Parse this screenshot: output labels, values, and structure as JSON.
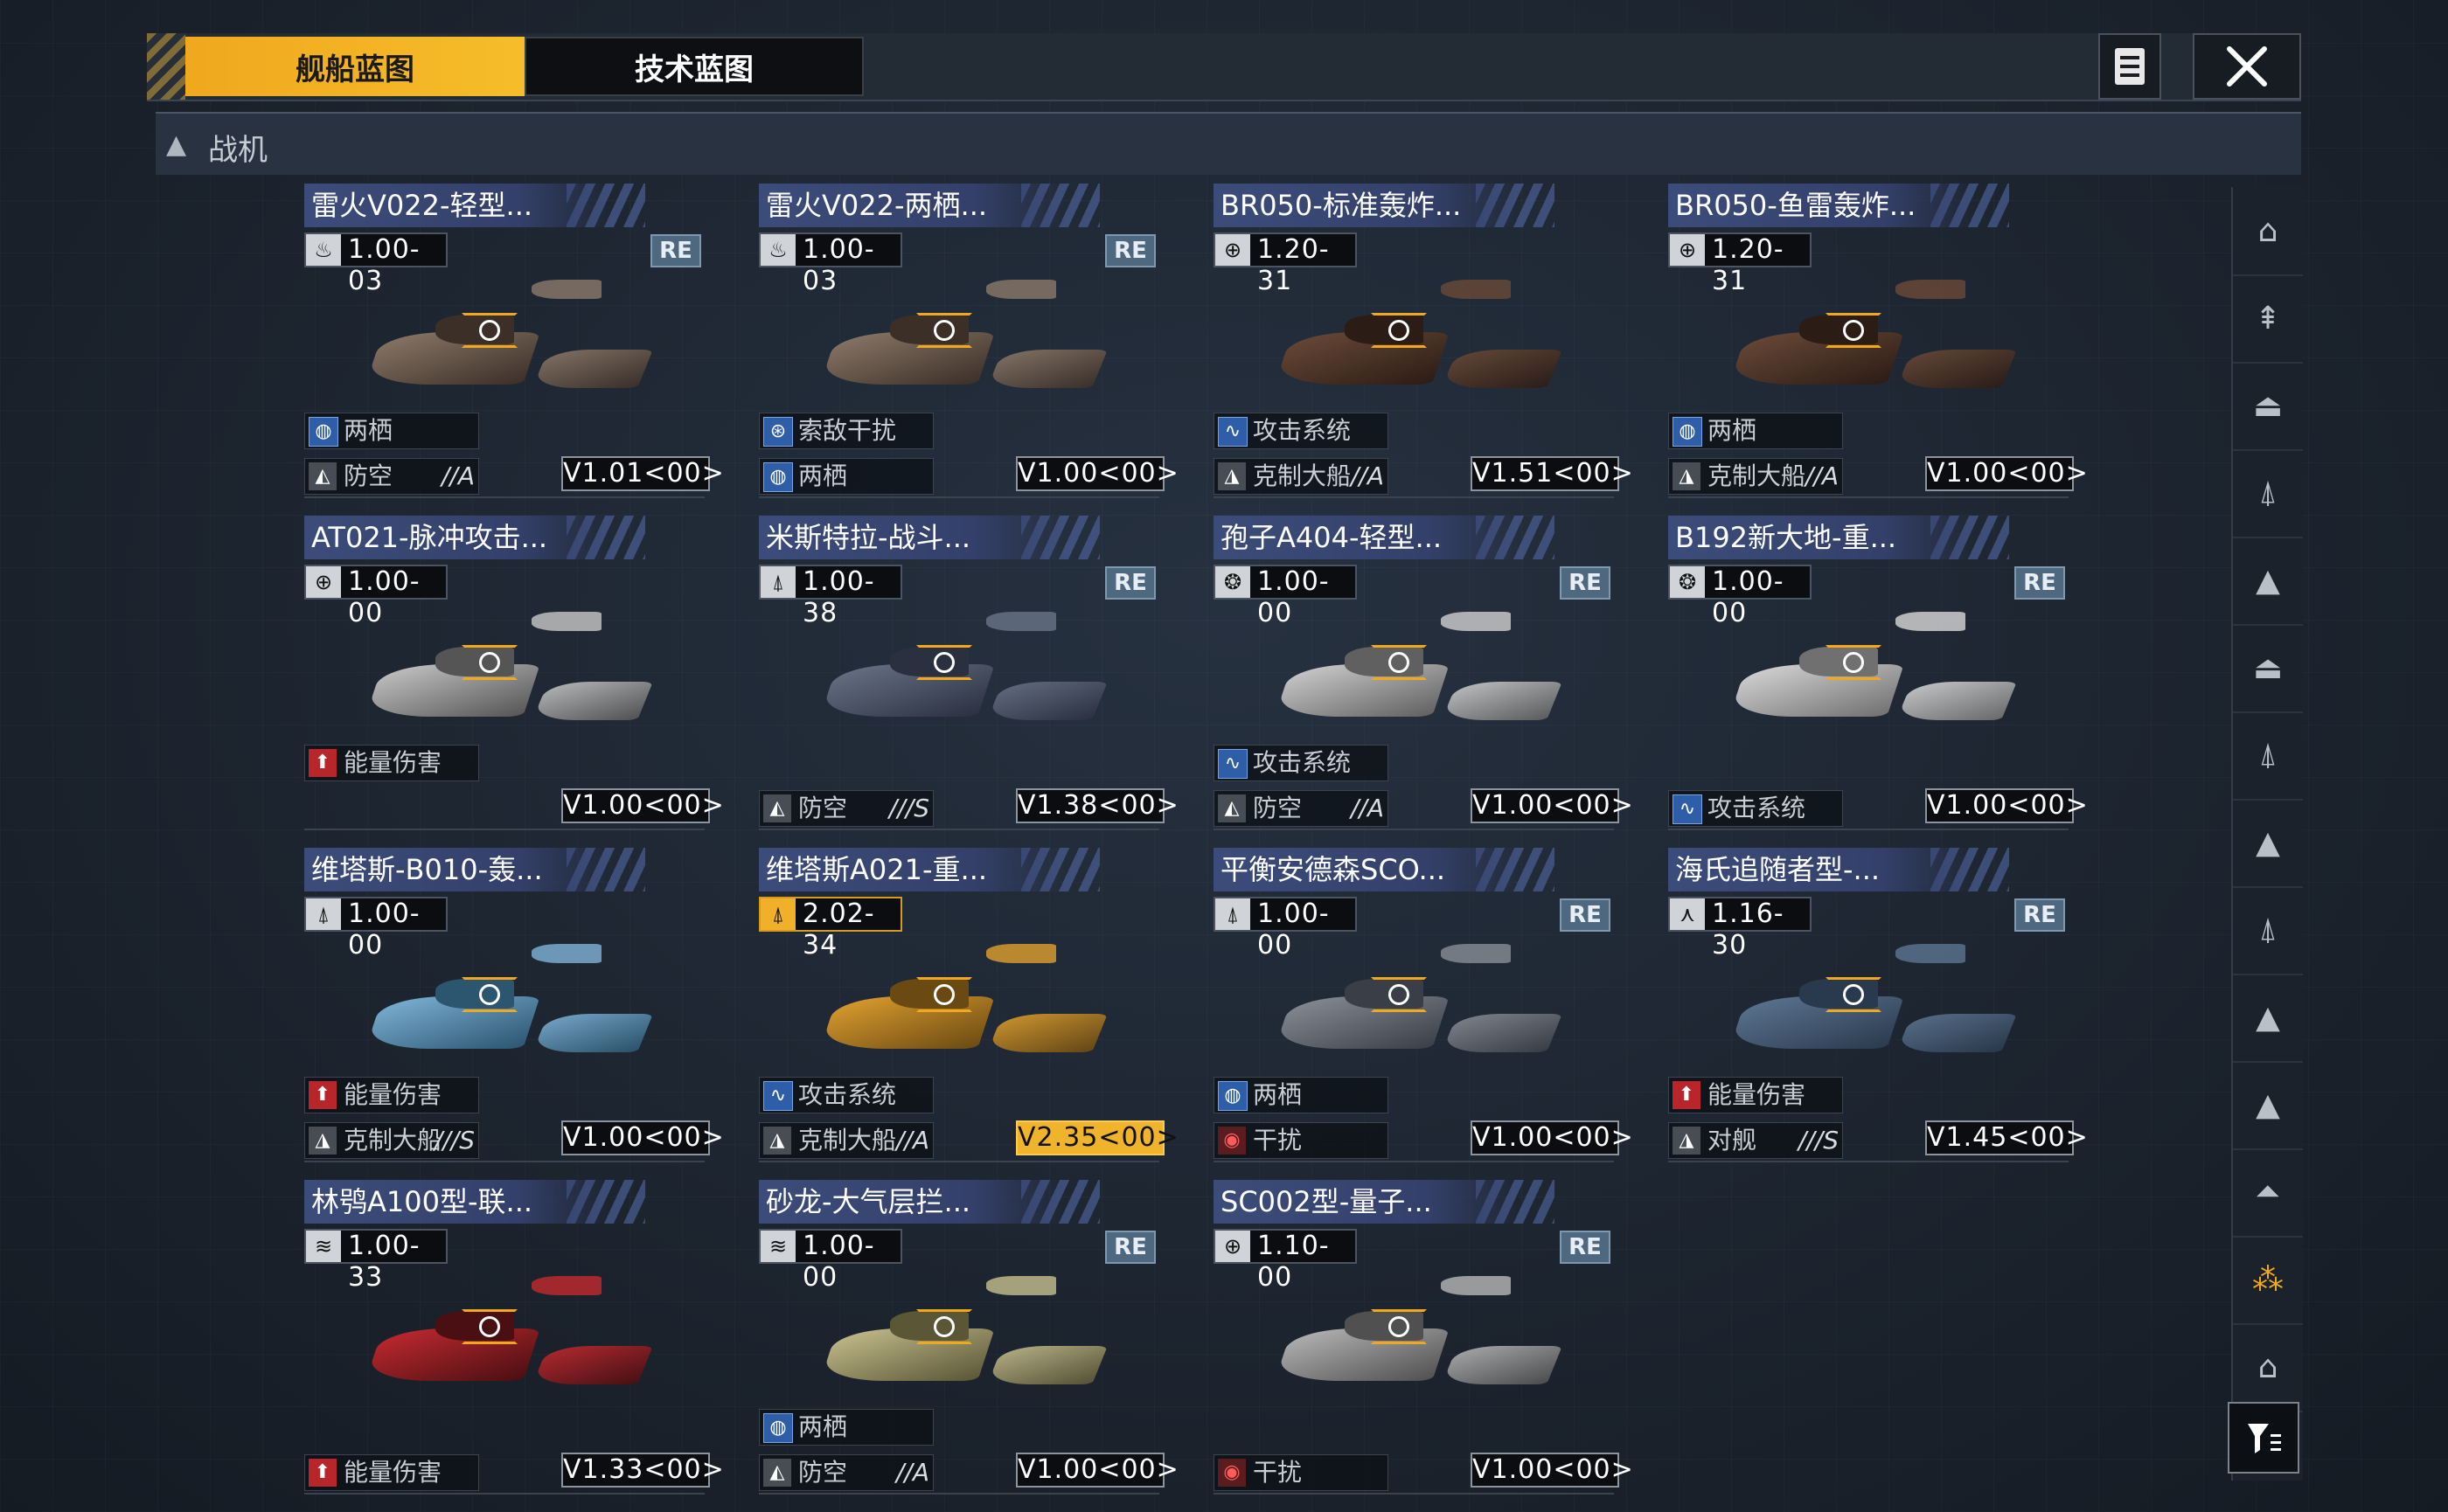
{
  "tabs": [
    {
      "label": "舰船蓝图",
      "active": true
    },
    {
      "label": "技术蓝图",
      "active": false
    }
  ],
  "header_icons": {
    "doc": "document-list-icon",
    "close": "close-icon"
  },
  "section": {
    "label": "战机",
    "icon": "fighter-category-icon"
  },
  "colors": {
    "accent": "#f0a81e",
    "title_bg": "#3c4c7a",
    "re_badge": "#4e6880",
    "damage_red": "#b8262c",
    "amphibious_blue": "#2f5ea8"
  },
  "cards": [
    {
      "title": "雷火V022-轻型...",
      "ver": "1.00-03",
      "type_icon": "flame-icon",
      "re": "RE",
      "f1": {
        "icon": "globe-icon",
        "label": "两栖",
        "grade": ""
      },
      "f2": {
        "icon": "anti-air-icon",
        "label": "防空",
        "grade": "//A"
      },
      "v": "V1.01<00>",
      "gold": false
    },
    {
      "title": "雷火V022-两栖...",
      "ver": "1.00-03",
      "type_icon": "flame-icon",
      "re": "RE",
      "f1": {
        "icon": "radar-icon",
        "label": "索敌干扰",
        "grade": ""
      },
      "f2": {
        "icon": "globe-icon",
        "label": "两栖",
        "grade": ""
      },
      "v": "V1.00<00>",
      "gold": false
    },
    {
      "title": "BR050-标准轰炸...",
      "ver": "1.20-31",
      "type_icon": "grid-globe-icon",
      "re": "",
      "f1": {
        "icon": "wave-icon",
        "label": "攻击系统",
        "grade": ""
      },
      "f2": {
        "icon": "anti-ship-icon",
        "label": "克制大船",
        "grade": "//A"
      },
      "v": "V1.51<00>",
      "gold": false
    },
    {
      "title": "BR050-鱼雷轰炸...",
      "ver": "1.20-31",
      "type_icon": "grid-globe-icon",
      "re": "",
      "f1": {
        "icon": "globe-icon",
        "label": "两栖",
        "grade": ""
      },
      "f2": {
        "icon": "anti-ship-icon",
        "label": "克制大船",
        "grade": "//A"
      },
      "v": "V1.00<00>",
      "gold": false
    },
    {
      "title": "AT021-脉冲攻击...",
      "ver": "1.00-00",
      "type_icon": "grid-globe-icon",
      "re": "",
      "f1": {
        "icon": "energy-icon",
        "label": "能量伤害",
        "grade": ""
      },
      "f2": null,
      "v": "V1.00<00>",
      "gold": false
    },
    {
      "title": "米斯特拉-战斗...",
      "ver": "1.00-38",
      "type_icon": "fighter-icon",
      "re": "RE",
      "f1": null,
      "f2": {
        "icon": "anti-air-icon",
        "label": "防空",
        "grade": "///S"
      },
      "v": "V1.38<00>",
      "gold": false
    },
    {
      "title": "孢子A404-轻型...",
      "ver": "1.00-00",
      "type_icon": "spore-icon",
      "re": "RE",
      "f1": {
        "icon": "wave-icon",
        "label": "攻击系统",
        "grade": ""
      },
      "f2": {
        "icon": "anti-air-icon",
        "label": "防空",
        "grade": "//A"
      },
      "v": "V1.00<00>",
      "gold": false
    },
    {
      "title": "B192新大地-重...",
      "ver": "1.00-00",
      "type_icon": "spore-icon",
      "re": "RE",
      "f1": null,
      "f2": {
        "icon": "wave-icon",
        "label": "攻击系统",
        "grade": ""
      },
      "v": "V1.00<00>",
      "gold": false
    },
    {
      "title": "维塔斯-B010-轰...",
      "ver": "1.00-00",
      "type_icon": "fighter-icon",
      "re": "",
      "f1": {
        "icon": "energy-icon",
        "label": "能量伤害",
        "grade": ""
      },
      "f2": {
        "icon": "anti-ship-icon",
        "label": "克制大船",
        "grade": "///S"
      },
      "v": "V1.00<00>",
      "gold": false
    },
    {
      "title": "维塔斯A021-重...",
      "ver": "2.02-34",
      "type_icon": "fighter-icon",
      "re": "",
      "f1": {
        "icon": "wave-icon",
        "label": "攻击系统",
        "grade": ""
      },
      "f2": {
        "icon": "anti-ship-icon",
        "label": "克制大船",
        "grade": "//A"
      },
      "v": "V2.35<00>",
      "gold": true
    },
    {
      "title": "平衡安德森SCO...",
      "ver": "1.00-00",
      "type_icon": "fighter-icon",
      "re": "RE",
      "f1": {
        "icon": "globe-icon",
        "label": "两栖",
        "grade": ""
      },
      "f2": {
        "icon": "jamming-icon",
        "label": "干扰",
        "grade": ""
      },
      "v": "V1.00<00>",
      "gold": false
    },
    {
      "title": "海氏追随者型-...",
      "ver": "1.16-30",
      "type_icon": "tri-wing-icon",
      "re": "RE",
      "f1": {
        "icon": "energy-icon",
        "label": "能量伤害",
        "grade": ""
      },
      "f2": {
        "icon": "anti-ship-icon",
        "label": "对舰",
        "grade": "///S"
      },
      "v": "V1.45<00>",
      "gold": false
    },
    {
      "title": "林鸮A100型-联...",
      "ver": "1.00-33",
      "type_icon": "speed-icon",
      "re": "",
      "f1": null,
      "f2": {
        "icon": "energy-icon",
        "label": "能量伤害",
        "grade": ""
      },
      "v": "V1.33<00>",
      "gold": false
    },
    {
      "title": "砂龙-大气层拦...",
      "ver": "1.00-00",
      "type_icon": "speed-icon",
      "re": "RE",
      "f1": {
        "icon": "globe-icon",
        "label": "两栖",
        "grade": ""
      },
      "f2": {
        "icon": "anti-air-icon",
        "label": "防空",
        "grade": "//A"
      },
      "v": "V1.00<00>",
      "gold": false
    },
    {
      "title": "SC002型-量子...",
      "ver": "1.10-00",
      "type_icon": "grid-globe-icon",
      "re": "RE",
      "f1": null,
      "f2": {
        "icon": "jamming-icon",
        "label": "干扰",
        "grade": ""
      },
      "v": "V1.00<00>",
      "gold": false
    }
  ],
  "filters": [
    "carrier-icon",
    "cruiser-icon",
    "battleship-icon",
    "frigate-icon",
    "destroyer-icon",
    "heavy-icon",
    "corvette-icon",
    "escort-icon",
    "gunship-icon",
    "support-icon",
    "light-icon",
    "lander-icon",
    "fighter-filter-icon",
    "shelter-icon"
  ],
  "active_filter_index": 12,
  "filter_button_icon": "filter-icon"
}
